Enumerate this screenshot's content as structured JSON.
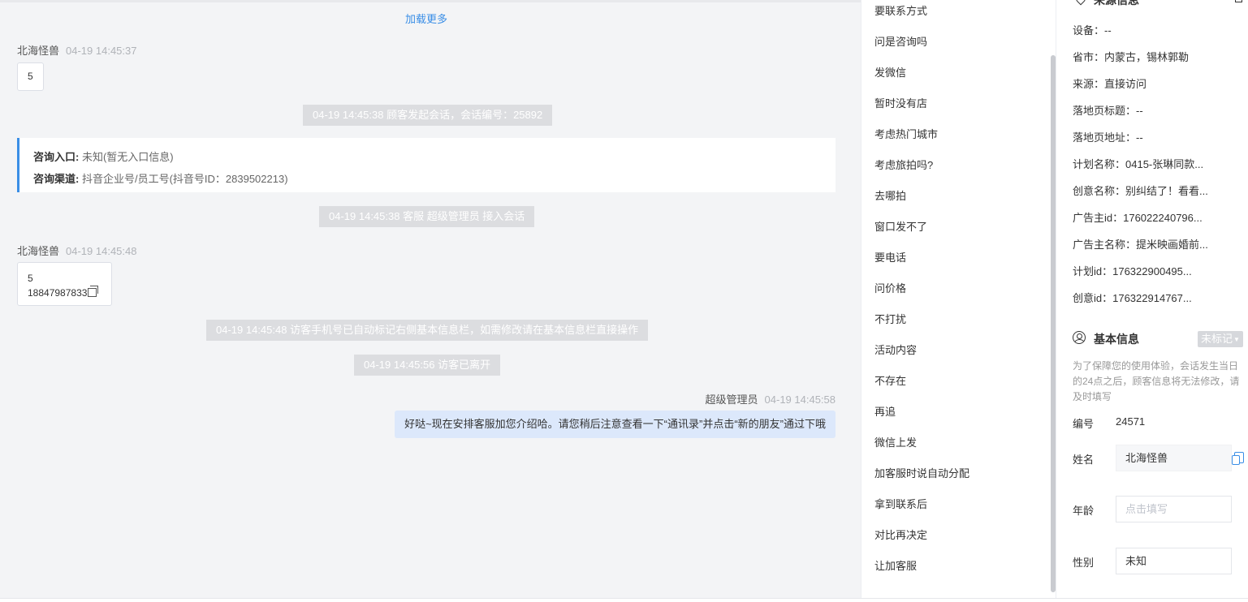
{
  "chat": {
    "load_more": "加载更多",
    "messages": [
      {
        "sender": "北海怪兽",
        "time": "04-19 14:45:37",
        "text": "5"
      },
      {
        "system": "04-19 14:45:38 顾客发起会话，会话编号：25892"
      },
      {
        "entry_label": "咨询入口:",
        "entry_value": "未知(暂无入口信息)",
        "channel_label": "咨询渠道:",
        "channel_value": "抖音企业号/员工号(抖音号ID：2839502213)"
      },
      {
        "system": "04-19 14:45:38 客服 超级管理员 接入会话"
      },
      {
        "sender": "北海怪兽",
        "time": "04-19 14:45:48",
        "line1": "5",
        "line2": "18847987833"
      },
      {
        "system": "04-19 14:45:48 访客手机号已自动标记右侧基本信息栏，如需修改请在基本信息栏直接操作"
      },
      {
        "system": "04-19 14:45:56 访客已离开"
      },
      {
        "sender": "超级管理员",
        "time": "04-19 14:45:58",
        "text": "好哒~现在安排客服加您介绍哈。请您稍后注意查看一下“通讯录”并点击“新的朋友”通过下哦"
      }
    ]
  },
  "quick_replies": [
    "要联系方式",
    "问是咨询吗",
    "发微信",
    "暂时没有店",
    "考虑热门城市",
    "考虑旅拍吗?",
    "去哪拍",
    "窗口发不了",
    "要电话",
    "问价格",
    "不打扰",
    "活动内容",
    "不存在",
    "再追",
    "微信上发",
    "加客服时说自动分配",
    "拿到联系后",
    "对比再决定",
    "让加客服"
  ],
  "source_info": {
    "title": "来源信息",
    "rows": [
      "设备：--",
      "省市：内蒙古，锡林郭勒",
      "来源：直接访问",
      "落地页标题：--",
      "落地页地址：--",
      "计划名称：0415-张琳同款...",
      "创意名称：别纠结了！看看...",
      "广告主id：176022240796...",
      "广告主名称：提米映画婚前...",
      "计划id：176322900495...",
      "创意id：176322914767..."
    ]
  },
  "basic_info": {
    "title": "基本信息",
    "tag_button": "未标记",
    "notice": "为了保障您的使用体验，会话发生当日的24点之后，顾客信息将无法修改，请及时填写",
    "id_label": "编号",
    "id_value": "24571",
    "name_label": "姓名",
    "name_value": "北海怪兽",
    "age_label": "年龄",
    "age_placeholder": "点击填写",
    "gender_label": "性别",
    "gender_value": "未知"
  },
  "colors": {
    "accent": "#3a8ee6",
    "system_bg": "#dcdde0",
    "outgoing_bg": "#dce8fb"
  }
}
